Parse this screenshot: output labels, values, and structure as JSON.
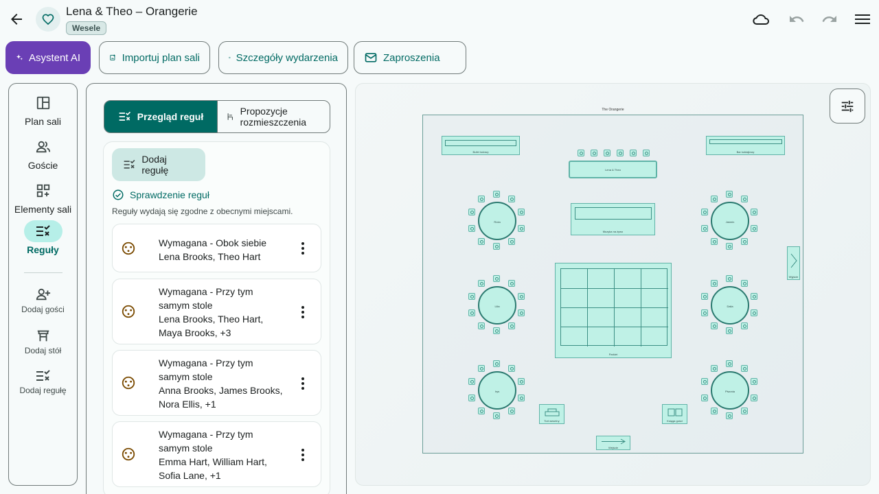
{
  "header": {
    "title": "Lena & Theo – Orangerie",
    "chip": "Wesele"
  },
  "toolbar": {
    "ai": "Asystent AI",
    "import": "Importuj plan sali",
    "details": "Szczegóły wydarzenia",
    "invites": "Zaproszenia"
  },
  "nav": {
    "items": [
      {
        "label": "Plan sali",
        "icon": "floorplan-icon"
      },
      {
        "label": "Goście",
        "icon": "guests-icon"
      },
      {
        "label": "Elementy sali",
        "icon": "room-elements-icon"
      },
      {
        "label": "Reguły",
        "icon": "rules-icon"
      }
    ],
    "actions": [
      {
        "label": "Dodaj gości",
        "icon": "add-person-icon"
      },
      {
        "label": "Dodaj stół",
        "icon": "table-icon"
      },
      {
        "label": "Dodaj regułę",
        "icon": "add-rule-icon"
      }
    ]
  },
  "rules_panel": {
    "seg_active": "Przegląd reguł",
    "seg_inactive": "Propozycje rozmieszczenia",
    "add_rule": "Dodaj regułę",
    "check_title": "Sprawdzenie reguł",
    "check_desc": "Reguły wydają się zgodne z obecnymi miejscami.",
    "rules": [
      {
        "type": "Wymagana - Obok siebie",
        "guests": "Lena Brooks, Theo Hart"
      },
      {
        "type": "Wymagana - Przy tym samym stole",
        "guests": "Lena Brooks, Theo Hart, Maya Brooks, +3"
      },
      {
        "type": "Wymagana - Przy tym samym stole",
        "guests": "Anna Brooks, James Brooks, Nora Ellis, +1"
      },
      {
        "type": "Wymagana - Przy tym samym stole",
        "guests": "Emma Hart, William Hart, Sofia Lane, +1"
      }
    ]
  },
  "floorplan": {
    "room_name": "The Orangerie",
    "elements": {
      "buffet": "Bufet lodowy",
      "head": "Lena & Theo",
      "bar": "Bar koktajlowy",
      "music": "Muzyka na żywo",
      "dance": "Parkiet",
      "exit": "Wyjście",
      "cake": "Tort weselny",
      "guestbook": "Księga gości",
      "entrance": "Wejście"
    },
    "tables": [
      "Róża",
      "Jaśmin",
      "Lilia",
      "Dalia",
      "Irys",
      "Piwonia"
    ]
  }
}
